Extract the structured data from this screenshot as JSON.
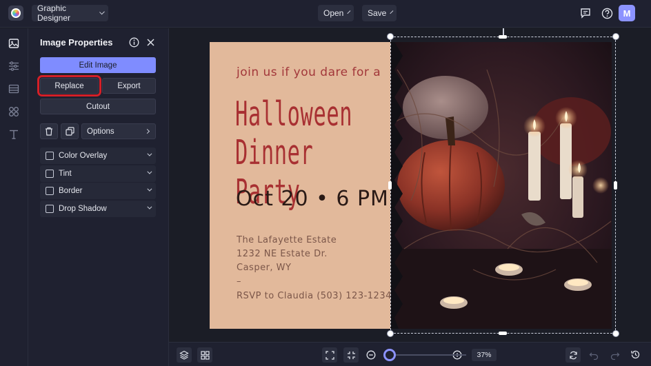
{
  "app": {
    "mode_label": "Graphic Designer",
    "open_label": "Open",
    "save_label": "Save",
    "avatar_initial": "M",
    "accent_color": "#7f8cff"
  },
  "panel": {
    "title": "Image Properties",
    "edit_image": "Edit Image",
    "replace": "Replace",
    "export": "Export",
    "cutout": "Cutout",
    "options": "Options",
    "effects": [
      {
        "label": "Color Overlay",
        "checked": false
      },
      {
        "label": "Tint",
        "checked": false
      },
      {
        "label": "Border",
        "checked": false
      },
      {
        "label": "Drop Shadow",
        "checked": false
      }
    ]
  },
  "design": {
    "intro": "join us if you dare for a",
    "title_line1": "Halloween",
    "title_line2": "Dinner Party",
    "date": "Oct 20 • 6 PM",
    "address": [
      "The Lafayette Estate",
      "1232 NE Estate Dr.",
      "Casper, WY",
      "–",
      "RSVP to Claudia (503) 123-1234"
    ],
    "bg_color": "#e2b99b",
    "title_color": "#a83032"
  },
  "zoom": {
    "value": "37%"
  }
}
